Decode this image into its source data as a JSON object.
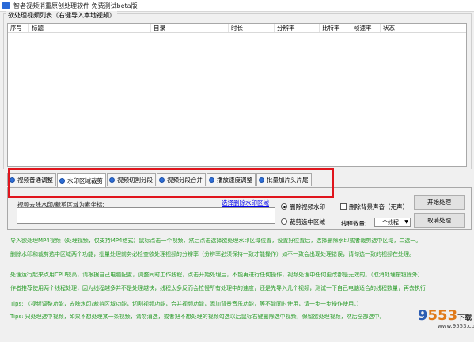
{
  "window": {
    "title": "智者视频消重原创处理软件 免费测试beta版"
  },
  "list": {
    "group_label": "欲处理视频列表（右键导入本地视频）",
    "columns": [
      "序号",
      "标题",
      "目录",
      "时长",
      "分辨率",
      "比特率",
      "帧速率",
      "状态"
    ]
  },
  "tabs": [
    {
      "label": "视频普通调整"
    },
    {
      "label": "水印区域裁剪"
    },
    {
      "label": "视频切割分段"
    },
    {
      "label": "视频分段合并"
    },
    {
      "label": "播放速度调整"
    },
    {
      "label": "批量加片头片尾"
    }
  ],
  "panel": {
    "coord_label": "视频去除水印/裁剪区域为素坐标:",
    "coord_value": "",
    "coord_link": "选择删除水印区域",
    "radio_remove_wm": "删除视频水印",
    "radio_crop": "裁剪选中区域",
    "checkbox_remove_bg": "删除背景声音（无声）",
    "threads_label": "线程数量:",
    "threads_value": "一个线程",
    "start_button": "开始处理",
    "cancel_button": "取消处理"
  },
  "info_lines": [
    "导入欲处理MP4视频（处理视频，仅支持MP4格式）鼠标点击一个视频，然后点击选择欲处理水印区域位置，设置好位置后，选择删除水印或者裁剪选中区域，二选一。",
    "删除水印和裁剪选中区域两个功能，批量处理前务必检查欲处理视频的分辨率（分辨率必须保持一致才能操作）如不一致会出现处理错误，请勾选一致的视频在处理。",
    "处理运行起来点用CPU较高，请根据自己电脑配置，调整同时工作线程，点击开始处理后，不能再进行任何操作，视频处理中任何更改都是无效的。（取消处理按钮除外）",
    "作者推荐使用两个线程处理，因为线程越多并不是处理越快，线程太多反而会拉慢所有处理中的速度，还是先导入几个视频，测试一下自己电脑适合的线程数量，再去执行",
    "Tips: （视频调整功能，去除水印/裁剪区域功能，切割视频功能，合并视频功能，添加背景音乐功能，等不能同时使用，请一步一步操作使用。）",
    "Tips: 只处理选中视频，如果不想处理某一条视频，请勿消选，或者把不想处理的视频勾选以后鼠标右键删除选中视频，保留欲处理视频，然后全部选中。"
  ],
  "watermark": {
    "text_a": "9",
    "text_b": "553",
    "suffix": "下载",
    "sub": "www.9553.com"
  },
  "colors": {
    "highlight": "#e0141c",
    "info_text": "#2a9d2a",
    "tab_icon": "#2f6fd6"
  }
}
